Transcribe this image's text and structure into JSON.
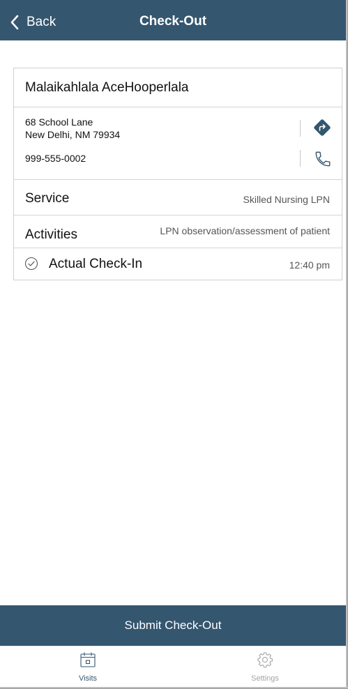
{
  "header": {
    "back_label": "Back",
    "title": "Check-Out"
  },
  "patient": {
    "name": "Malaikahlala AceHooperlala",
    "address_line1": "68 School Lane",
    "address_line2": "New Delhi, NM 79934",
    "phone": "999-555-0002"
  },
  "rows": {
    "service_label": "Service",
    "service_value": "Skilled Nursing LPN",
    "activities_label": "Activities",
    "activities_value": "LPN observation/assessment of patient",
    "checkin_label": "Actual Check-In",
    "checkin_value": "12:40 pm"
  },
  "submit_label": "Submit Check-Out",
  "tabs": [
    {
      "label": "Visits",
      "icon": "calendar-icon",
      "active": true
    },
    {
      "label": "Settings",
      "icon": "gear-icon",
      "active": false
    }
  ],
  "colors": {
    "brand": "#34566f",
    "tab_inactive": "#a3a3a3"
  }
}
